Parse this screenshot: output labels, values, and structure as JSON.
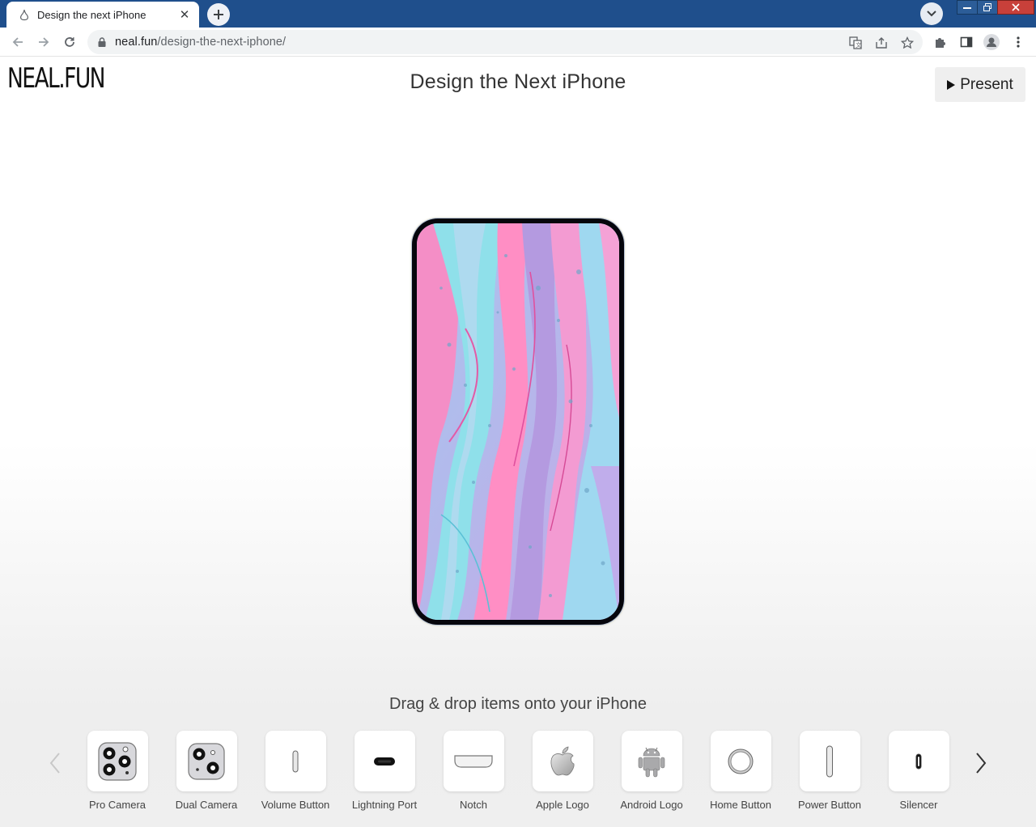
{
  "browser": {
    "tab_title": "Design the next iPhone",
    "url_domain": "neal.fun",
    "url_path": "/design-the-next-iphone/"
  },
  "header": {
    "logo": "NEAL.FUN",
    "title": "Design the Next iPhone",
    "present_label": "Present"
  },
  "instructions": "Drag & drop items onto your iPhone",
  "items": [
    {
      "label": "Pro Camera",
      "icon": "pro-camera-icon"
    },
    {
      "label": "Dual Camera",
      "icon": "dual-camera-icon"
    },
    {
      "label": "Volume Button",
      "icon": "volume-button-icon"
    },
    {
      "label": "Lightning Port",
      "icon": "lightning-port-icon"
    },
    {
      "label": "Notch",
      "icon": "notch-icon"
    },
    {
      "label": "Apple Logo",
      "icon": "apple-logo-icon"
    },
    {
      "label": "Android Logo",
      "icon": "android-logo-icon"
    },
    {
      "label": "Home Button",
      "icon": "home-button-icon"
    },
    {
      "label": "Power Button",
      "icon": "power-button-icon"
    },
    {
      "label": "Silencer",
      "icon": "silencer-icon"
    }
  ],
  "colors": {
    "tabstrip": "#1f4f8c",
    "phone_frame": "#06060c",
    "wallpaper_pink": "#ff8fc8",
    "wallpaper_cyan": "#8fe0ea",
    "wallpaper_purple": "#b49ae0"
  }
}
